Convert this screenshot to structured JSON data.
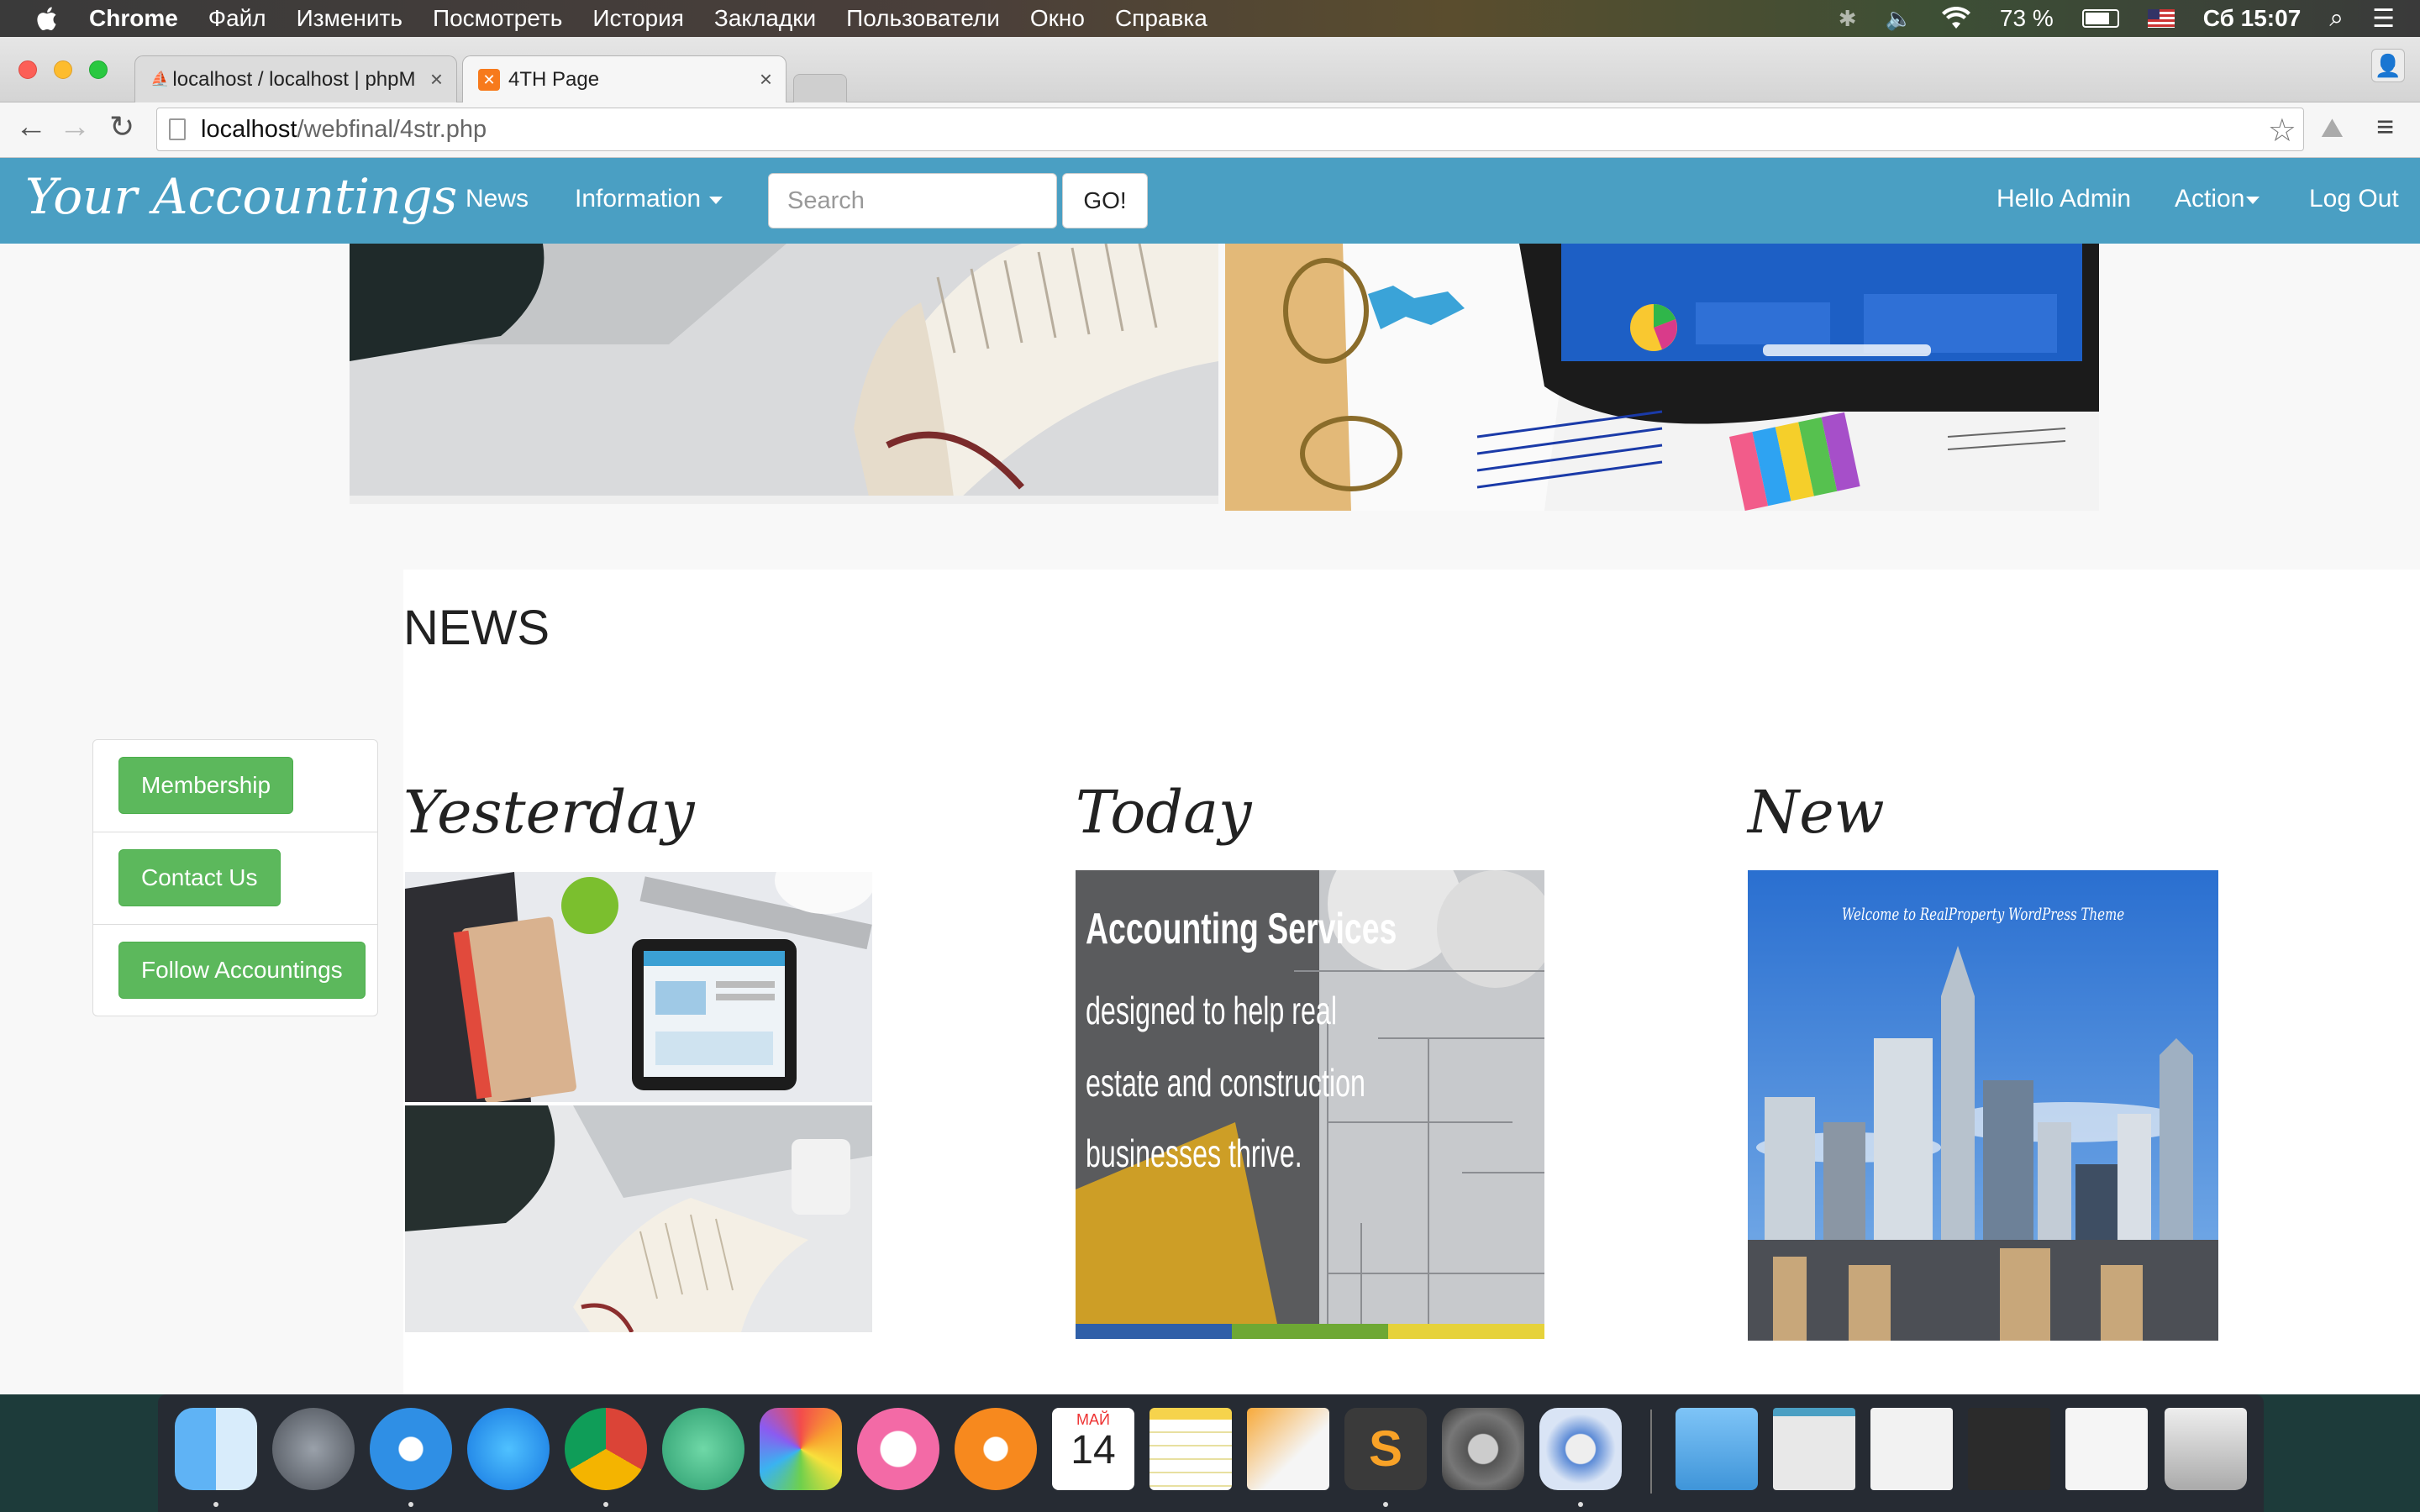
{
  "menubar": {
    "app": "Chrome",
    "items": [
      "Файл",
      "Изменить",
      "Посмотреть",
      "История",
      "Закладки",
      "Пользователи",
      "Окно",
      "Справка"
    ],
    "battery": "73 %",
    "clock": "Сб 15:07"
  },
  "browser": {
    "tabs": [
      {
        "title": "localhost / localhost | phpM"
      },
      {
        "title": "4TH Page"
      }
    ],
    "url_host": "localhost",
    "url_path": "/webfinal/4str.php"
  },
  "navbar": {
    "brand": "Your Accountings",
    "links": {
      "news": "News",
      "information": "Information"
    },
    "search_placeholder": "Search",
    "go": "GO!",
    "hello": "Hello Admin",
    "action": "Action",
    "logout": "Log Out"
  },
  "sidebar": {
    "membership": "Membership",
    "contact": "Contact Us",
    "follow": "Follow Accountings"
  },
  "news": {
    "title": "NEWS",
    "columns": [
      "Yesterday",
      "Today",
      "New"
    ],
    "today_image_text": {
      "heading": "Accounting Services",
      "lines": [
        "designed to help real",
        "estate and construction",
        "businesses thrive."
      ]
    },
    "new_image_text": "Welcome to RealProperty WordPress Theme"
  },
  "dock": {
    "calendar_month": "МАЙ",
    "calendar_day": "14"
  }
}
